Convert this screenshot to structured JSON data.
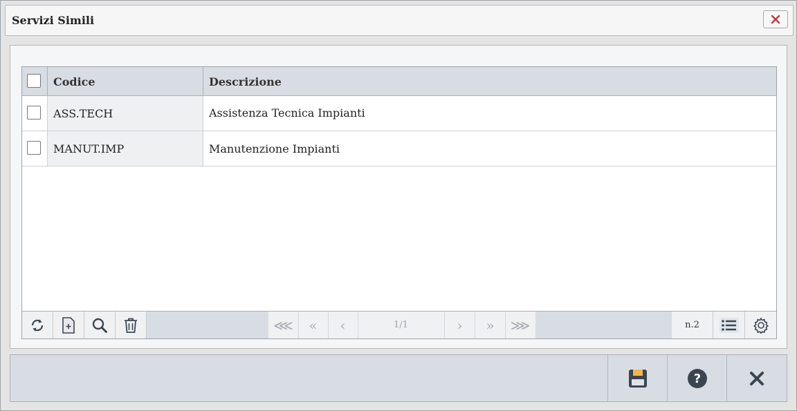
{
  "dialog": {
    "title": "Servizi Simili"
  },
  "grid": {
    "columns": [
      {
        "label": "Codice"
      },
      {
        "label": "Descrizione"
      }
    ],
    "rows": [
      {
        "code": "ASS.TECH",
        "description": "Assistenza Tecnica Impianti"
      },
      {
        "code": "MANUT.IMP",
        "description": "Manutenzione Impianti"
      }
    ]
  },
  "toolbar": {
    "icons": [
      "refresh-icon",
      "add-document-icon",
      "search-icon",
      "trash-icon"
    ],
    "pager": {
      "first_far": "⋘",
      "first": "«",
      "prev": "‹",
      "page_label": "1/1",
      "next": "›",
      "last": "»",
      "last_far": "⋙"
    },
    "record_count": "n.2",
    "right_icons": [
      "list-icon",
      "gear-icon"
    ]
  },
  "footer": {
    "icons": [
      "save-icon",
      "help-icon",
      "close-icon"
    ]
  },
  "colors": {
    "close_red": "#c0393b",
    "icon_dark": "#3b4552",
    "save_accent": "#f0b64c"
  }
}
